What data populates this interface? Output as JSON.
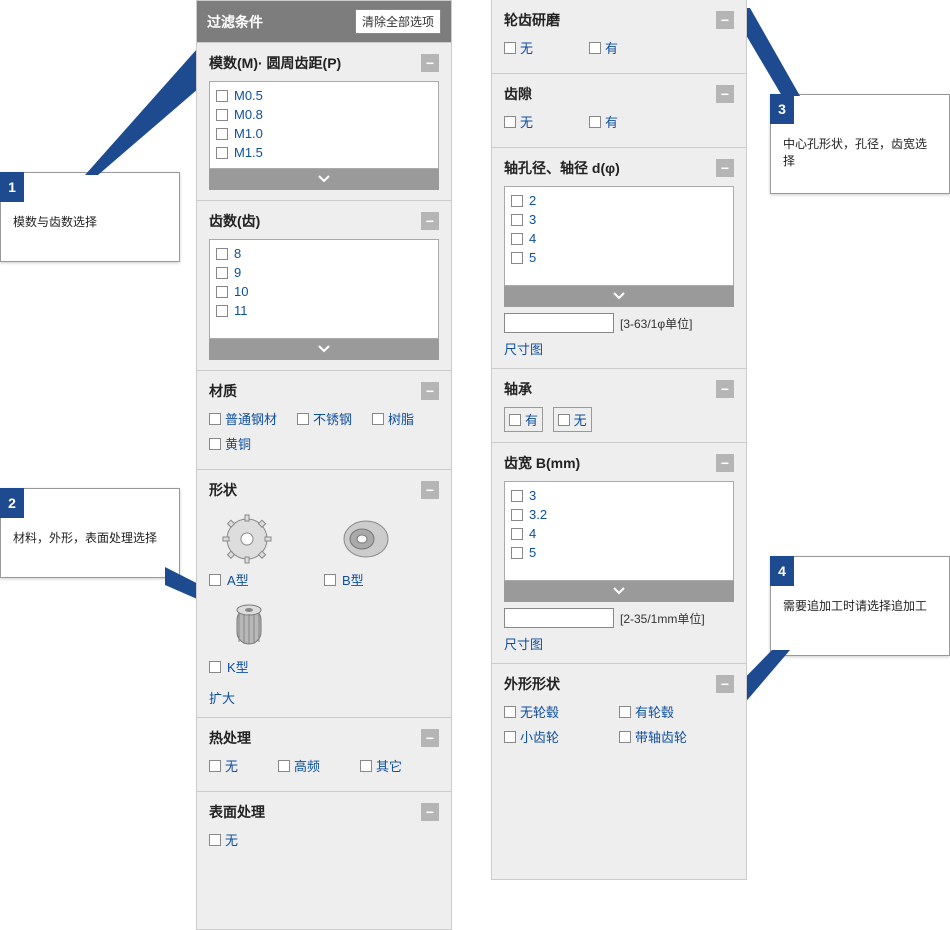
{
  "callouts": {
    "c1": {
      "num": "1",
      "text": "模数与齿数选择"
    },
    "c2": {
      "num": "2",
      "text": "材料，外形，表面处理选择"
    },
    "c3": {
      "num": "3",
      "text": "中心孔形状，孔径，齿宽选择"
    },
    "c4": {
      "num": "4",
      "text": "需要追加工时请选择追加工"
    }
  },
  "filter": {
    "header": "过滤条件",
    "clear": "清除全部选项",
    "sections": {
      "module": {
        "title": "模数(M)· 圆周齿距(P)",
        "items": [
          "M0.5",
          "M0.8",
          "M1.0",
          "M1.5"
        ]
      },
      "teeth": {
        "title": "齿数(齿)",
        "items": [
          "8",
          "9",
          "10",
          "11"
        ]
      },
      "material": {
        "title": "材质",
        "items": [
          "普通钢材",
          "不锈钢",
          "树脂",
          "黄铜"
        ]
      },
      "shape": {
        "title": "形状",
        "items": [
          "A型",
          "B型",
          "K型"
        ],
        "enlarge": "扩大"
      },
      "heat": {
        "title": "热处理",
        "items": [
          "无",
          "高频",
          "其它"
        ]
      },
      "surface": {
        "title": "表面处理",
        "items": [
          "无"
        ]
      },
      "grind": {
        "title": "轮齿研磨",
        "items": [
          "无",
          "有"
        ]
      },
      "backlash": {
        "title": "齿隙",
        "items": [
          "无",
          "有"
        ]
      },
      "bore": {
        "title": "轴孔径、轴径 d(φ)",
        "items": [
          "2",
          "3",
          "4",
          "5"
        ],
        "hint": "[3-63/1φ单位]",
        "dimlink": "尺寸图"
      },
      "bearing": {
        "title": "轴承",
        "items": [
          "有",
          "无"
        ]
      },
      "width": {
        "title": "齿宽 B(mm)",
        "items": [
          "3",
          "3.2",
          "4",
          "5"
        ],
        "hint": "[2-35/1mm单位]",
        "dimlink": "尺寸图"
      },
      "outform": {
        "title": "外形形状",
        "items": [
          "无轮毂",
          "有轮毂",
          "小齿轮",
          "带轴齿轮"
        ]
      }
    }
  }
}
